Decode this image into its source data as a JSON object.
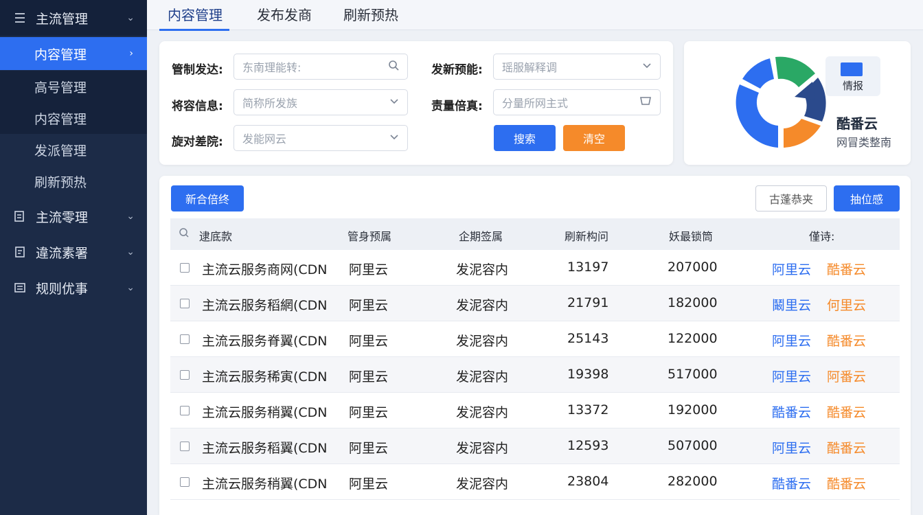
{
  "sidebar": {
    "groups": [
      {
        "label": "主流管理",
        "icon": "menu-icon"
      },
      {
        "label": "主流零理",
        "icon": "document-icon"
      },
      {
        "label": "違流素署",
        "icon": "clipboard-icon"
      },
      {
        "label": "规则优事",
        "icon": "list-icon"
      }
    ],
    "sub_items": [
      {
        "label": "内容管理"
      },
      {
        "label": "高号管理"
      },
      {
        "label": "内容管理"
      },
      {
        "label": "发派管理"
      },
      {
        "label": "刷新预热"
      }
    ]
  },
  "tabs": [
    {
      "label": "内容管理"
    },
    {
      "label": "发布发商"
    },
    {
      "label": "刷新预热"
    }
  ],
  "filters": {
    "f1": {
      "label": "管制发达:",
      "placeholder": "东南理能转:"
    },
    "f2": {
      "label": "发新预能:",
      "placeholder": "瑶服解释调"
    },
    "f3": {
      "label": "将容信息:",
      "placeholder": "简称所发族"
    },
    "f4": {
      "label": "责量倍真:",
      "placeholder": "分量所网主式"
    },
    "f5": {
      "label": "旋对差院:",
      "placeholder": "发能网云"
    },
    "search_btn": "搜索",
    "reset_btn": "清空"
  },
  "brand": {
    "tag_label": "情报",
    "name": "酷番云",
    "subtitle": "网冒类整南",
    "colors": {
      "blue": "#2d6ef0",
      "green": "#2aa865",
      "orange": "#f58a2a",
      "navy": "#2b4a8c"
    }
  },
  "table_toolbar": {
    "left_btn": "新合倍终",
    "right_outline_btn": "古蓬恭夹",
    "right_btn": "抽位感"
  },
  "table": {
    "headers": [
      "逮底款",
      "管身预属",
      "企期签属",
      "刷新构问",
      "妖最锁筒",
      "僅诗:"
    ],
    "rows": [
      {
        "name": "主流云服务商网(CDN",
        "provider": "阿里云",
        "status": "发泥容内",
        "num": "13197",
        "amount": "207000",
        "action1": "阿里云",
        "action2": "酷番云"
      },
      {
        "name": "主流云服务稻網(CDN",
        "provider": "阿里云",
        "status": "发泥容内",
        "num": "21791",
        "amount": "182000",
        "action1": "鬫里云",
        "action2": "何里云"
      },
      {
        "name": "主流云服务脊翼(CDN",
        "provider": "阿里云",
        "status": "发泥容内",
        "num": "25143",
        "amount": "122000",
        "action1": "阿里云",
        "action2": "酷番云"
      },
      {
        "name": "主流云服务稀寅(CDN",
        "provider": "阿里云",
        "status": "发泥容内",
        "num": "19398",
        "amount": "517000",
        "action1": "阿里云",
        "action2": "阿番云"
      },
      {
        "name": "主流云服务稍翼(CDN",
        "provider": "阿里云",
        "status": "发泥容内",
        "num": "13372",
        "amount": "192000",
        "action1": "酷番云",
        "action2": "酷番云"
      },
      {
        "name": "主流云服务稻翼(CDN",
        "provider": "阿里云",
        "status": "发泥容内",
        "num": "12593",
        "amount": "507000",
        "action1": "阿里云",
        "action2": "酷番云"
      },
      {
        "name": "主流云服务稍翼(CDN",
        "provider": "阿里云",
        "status": "发泥容内",
        "num": "23804",
        "amount": "282000",
        "action1": "酷番云",
        "action2": "酷番云"
      }
    ]
  }
}
